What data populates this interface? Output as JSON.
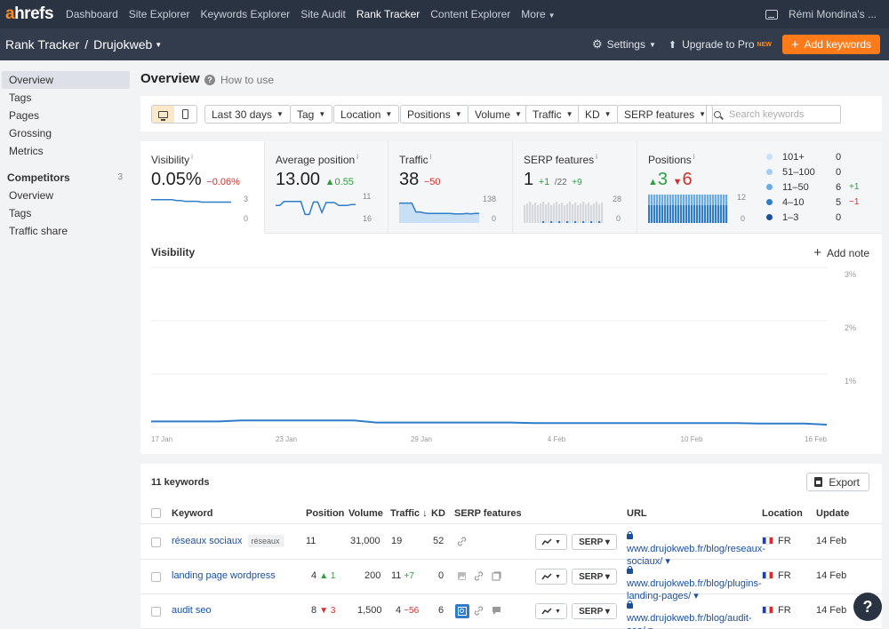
{
  "nav": {
    "logo_a": "a",
    "logo_rest": "hrefs",
    "links": [
      "Dashboard",
      "Site Explorer",
      "Keywords Explorer",
      "Site Audit",
      "Rank Tracker",
      "Content Explorer",
      "More"
    ],
    "user": "Rémi Mondina's ..."
  },
  "project": {
    "section": "Rank Tracker",
    "name": "Drujokweb",
    "settings": "Settings",
    "upgrade": "Upgrade to Pro",
    "upgrade_badge": "NEW",
    "add_keywords": "Add keywords"
  },
  "sidebar": {
    "items": [
      "Overview",
      "Tags",
      "Pages",
      "Grossing",
      "Metrics"
    ],
    "competitors_title": "Competitors",
    "competitors_count": "3",
    "competitor_items": [
      "Overview",
      "Tags",
      "Traffic share"
    ]
  },
  "page": {
    "title": "Overview",
    "how_to": "How to use"
  },
  "filters": {
    "date": "Last 30 days",
    "tag": "Tag",
    "location": "Location",
    "positions": "Positions",
    "volume": "Volume",
    "traffic": "Traffic",
    "kd": "KD",
    "serp_features": "SERP features",
    "search_placeholder": "Search keywords"
  },
  "metrics": {
    "visibility": {
      "label": "Visibility",
      "info": "i",
      "value": "0.05%",
      "delta": "−0.06%",
      "axis_top": "3",
      "axis_bottom": "0",
      "spark": [
        2.6,
        2.6,
        2.6,
        2.6,
        2.6,
        2.6,
        2.5,
        2.5,
        2.4,
        2.4,
        2.4,
        2.4,
        2.3,
        2.3,
        2.3,
        2.3,
        2.3,
        2.3,
        2.3,
        2.3
      ]
    },
    "avg_position": {
      "label": "Average position",
      "info": "i",
      "value": "13.00",
      "delta": "0.55",
      "axis_top": "11",
      "axis_bottom": "16",
      "spark": [
        13.2,
        13.2,
        12.4,
        12.4,
        12.4,
        12.4,
        12.4,
        15.0,
        15.0,
        12.5,
        12.5,
        14.6,
        12.6,
        12.6,
        12.6,
        13.2,
        13.2,
        13.2,
        13.0,
        13.0
      ]
    },
    "traffic": {
      "label": "Traffic",
      "info": "i",
      "value": "38",
      "delta": "−50",
      "axis_top": "138",
      "axis_bottom": "0",
      "spark": [
        88,
        88,
        88,
        88,
        45,
        45,
        40,
        38,
        38,
        38,
        38,
        38,
        38,
        36,
        36,
        36,
        38,
        36,
        38,
        38
      ]
    },
    "serp": {
      "label": "SERP features",
      "info": "i",
      "value": "1",
      "delta": "+1",
      "sub": "/22",
      "sub_delta": "+9",
      "axis_top": "28",
      "axis_bottom": "0"
    },
    "positions": {
      "label": "Positions",
      "info": "i",
      "up": "3",
      "down": "6",
      "axis_top": "12",
      "axis_bottom": "0"
    }
  },
  "position_legend": [
    {
      "label": "101+",
      "value": "0",
      "delta": "",
      "color": "#c8e1f7"
    },
    {
      "label": "51–100",
      "value": "0",
      "delta": "",
      "color": "#a6cdf0"
    },
    {
      "label": "11–50",
      "value": "6",
      "delta": "+1",
      "color": "#6aabe3"
    },
    {
      "label": "4–10",
      "value": "5",
      "delta": "−1",
      "color": "#2f7cc9"
    },
    {
      "label": "1–3",
      "value": "0",
      "delta": "",
      "color": "#1a4f9c"
    }
  ],
  "visibility_chart": {
    "title": "Visibility",
    "add_note": "Add note",
    "x_labels": [
      "17 Jan",
      "23 Jan",
      "29 Jan",
      "4 Feb",
      "10 Feb",
      "16 Feb"
    ],
    "y_labels": [
      "3%",
      "2%",
      "1%"
    ],
    "values": [
      0.11,
      0.11,
      0.11,
      0.11,
      0.13,
      0.13,
      0.13,
      0.13,
      0.13,
      0.13,
      0.09,
      0.09,
      0.09,
      0.09,
      0.09,
      0.09,
      0.09,
      0.08,
      0.08,
      0.08,
      0.08,
      0.08,
      0.08,
      0.08,
      0.08,
      0.08,
      0.08,
      0.07,
      0.07,
      0.07,
      0.05
    ]
  },
  "keywords": {
    "count_label": "11 keywords",
    "export": "Export",
    "headers": {
      "keyword": "Keyword",
      "position": "Position",
      "volume": "Volume",
      "traffic": "Traffic ↓",
      "kd": "KD",
      "serp": "SERP features",
      "url": "URL",
      "location": "Location",
      "update": "Update"
    },
    "serp_btn": "SERP ▾",
    "rows": [
      {
        "keyword": "réseaux sociaux",
        "tag": "réseaux",
        "position": "11",
        "pos_delta": "",
        "pos_dir": "",
        "volume": "31,000",
        "traffic": "19",
        "traffic_delta": "",
        "kd": "52",
        "url": "www.drujokweb.fr/blog/reseaux-sociaux/ ▾",
        "location": "FR",
        "update": "14 Feb"
      },
      {
        "keyword": "landing page wordpress",
        "tag": "",
        "position": "4",
        "pos_delta": "1",
        "pos_dir": "up",
        "volume": "200",
        "traffic": "11",
        "traffic_delta": "+7",
        "kd": "0",
        "url": "www.drujokweb.fr/blog/plugins-landing-pages/ ▾",
        "location": "FR",
        "update": "14 Feb"
      },
      {
        "keyword": "audit seo",
        "tag": "",
        "position": "8",
        "pos_delta": "3",
        "pos_dir": "down",
        "volume": "1,500",
        "traffic": "4",
        "traffic_delta": "−56",
        "kd": "6",
        "url": "www.drujokweb.fr/blog/audit-seo/ ▾",
        "location": "FR",
        "update": "14 Feb"
      }
    ]
  },
  "help_label": "?"
}
